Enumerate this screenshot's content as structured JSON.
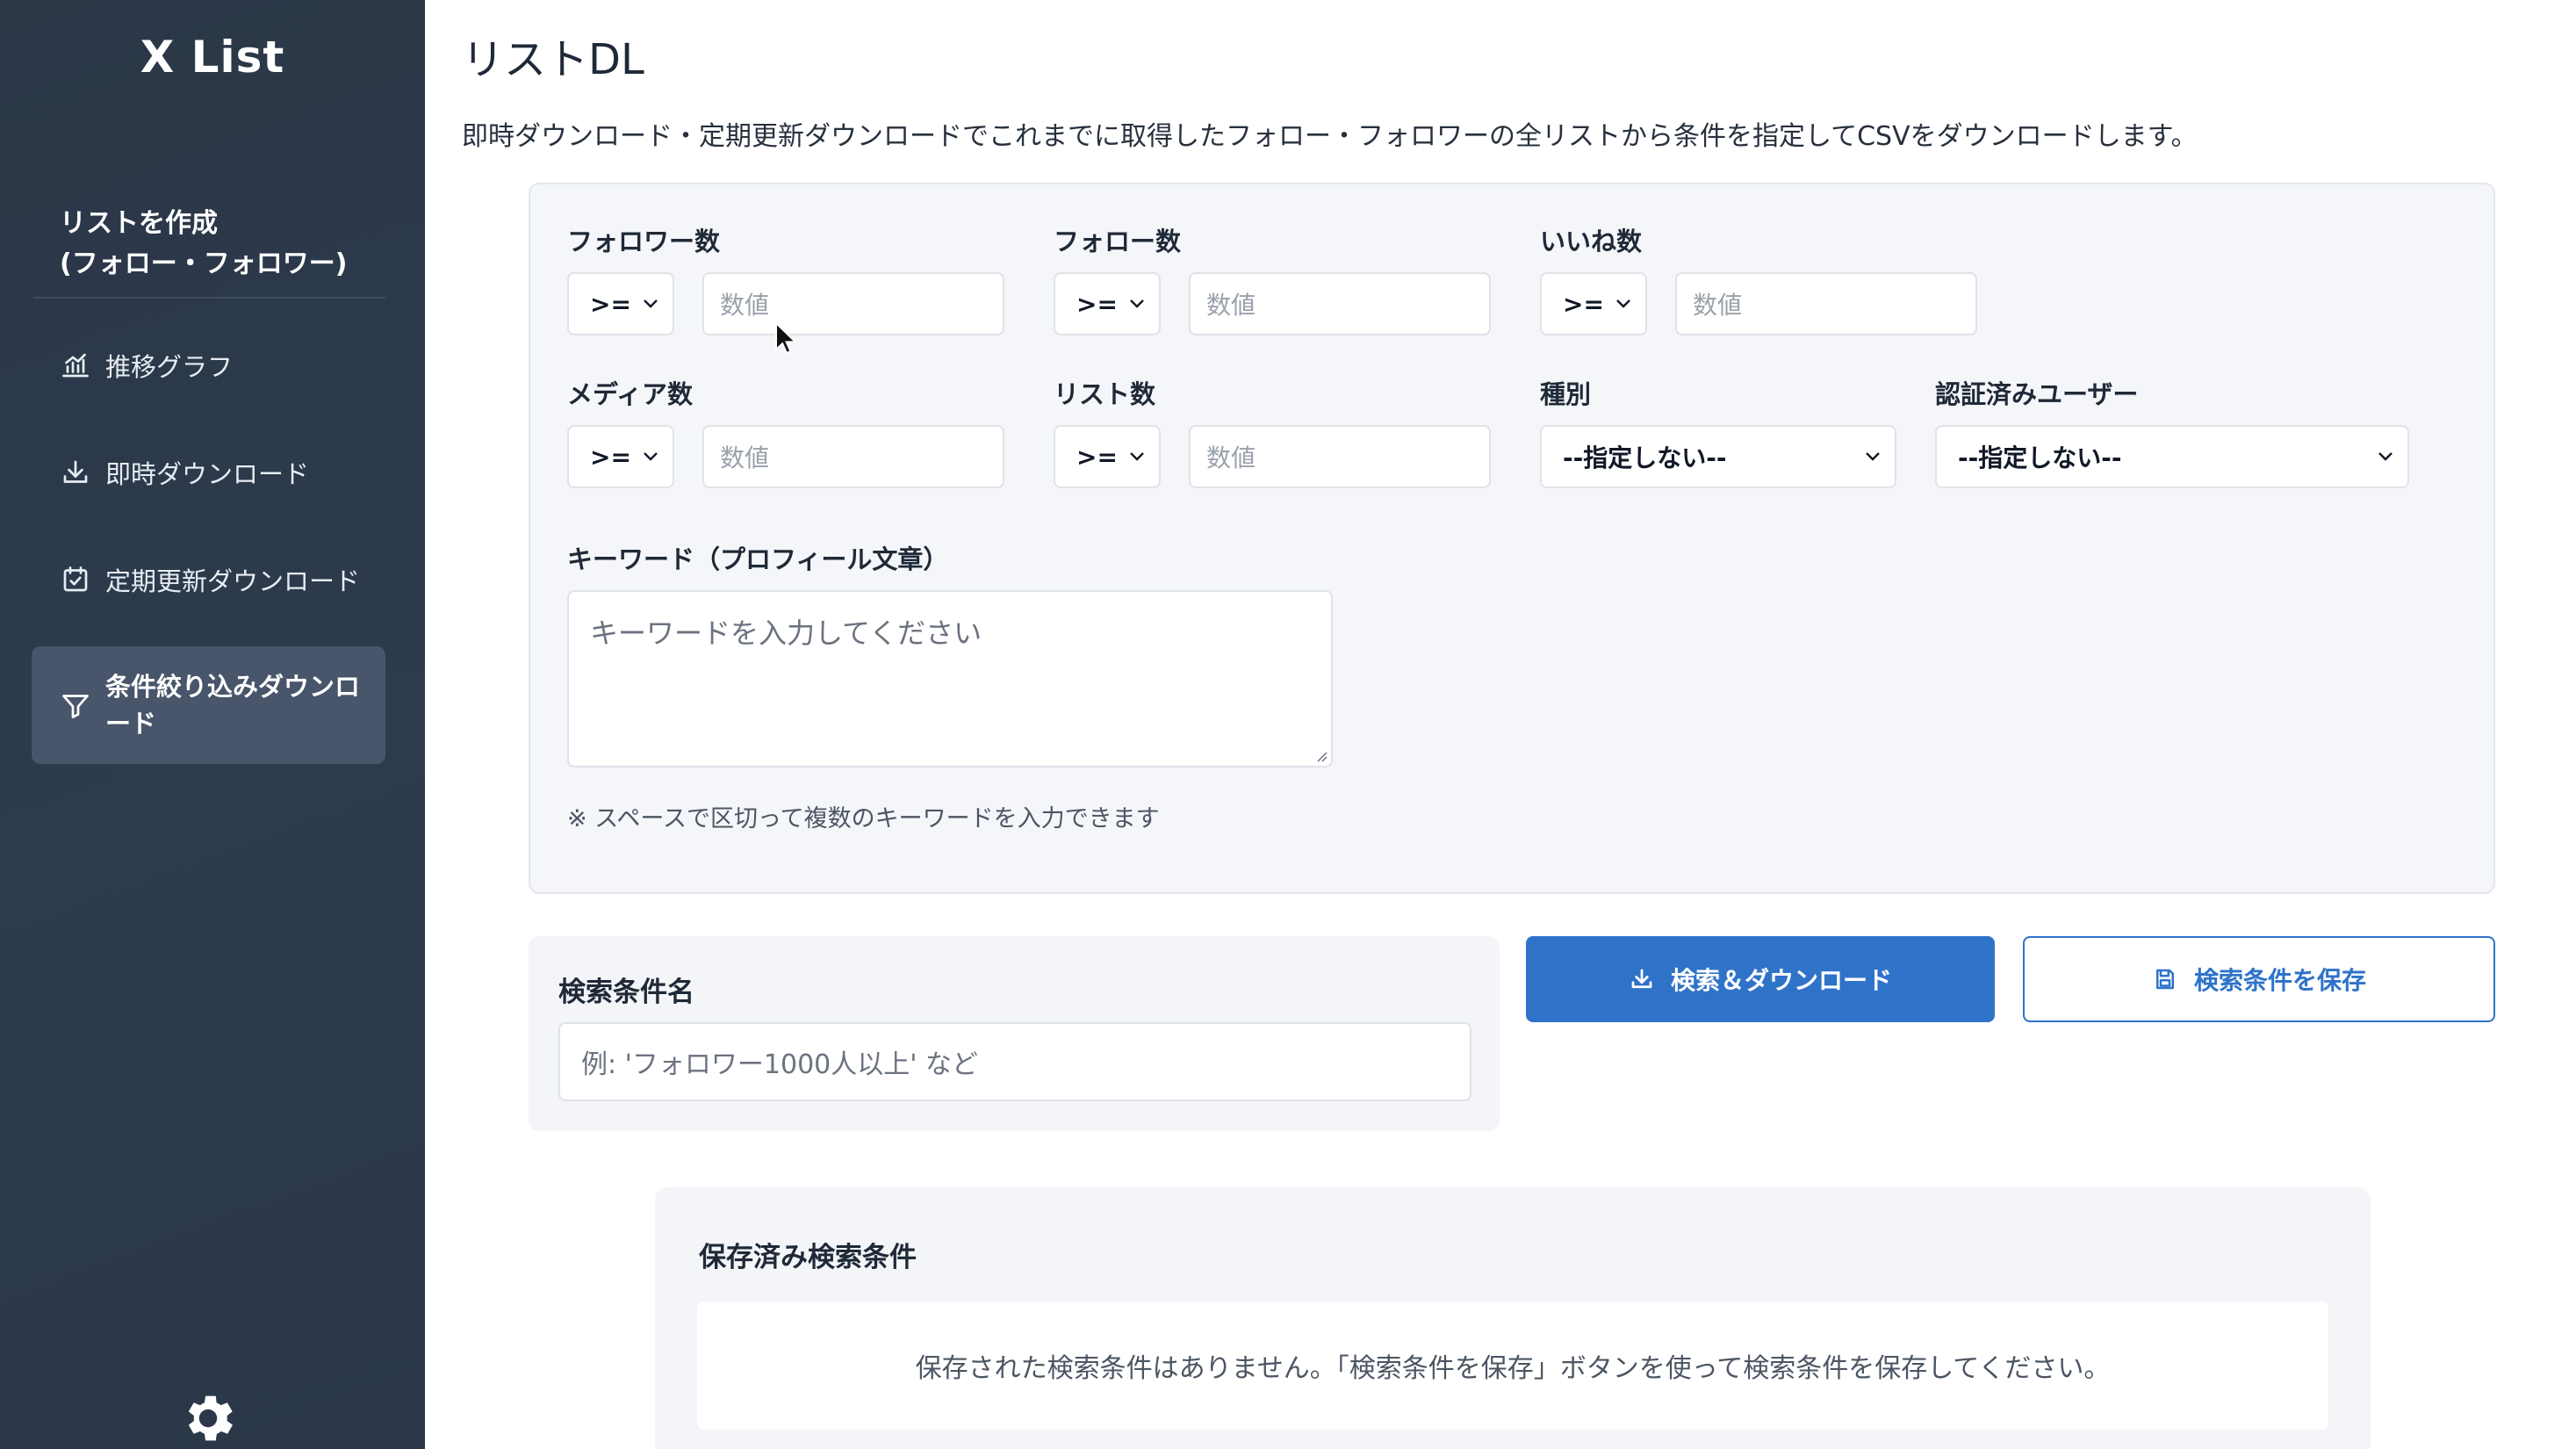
{
  "sidebar": {
    "brand": "X List",
    "heading_line1": "リストを作成",
    "heading_line2": "(フォロー・フォロワー)",
    "items": [
      {
        "label": "推移グラフ",
        "icon": "chart-icon"
      },
      {
        "label": "即時ダウンロード",
        "icon": "download-icon"
      },
      {
        "label": "定期更新ダウンロード",
        "icon": "calendar-check-icon"
      },
      {
        "label": "条件絞り込みダウンロード",
        "icon": "filter-icon",
        "active": true
      }
    ],
    "footer_icon": "gear-icon"
  },
  "page": {
    "title": "リストDL",
    "description": "即時ダウンロード・定期更新ダウンロードでこれまでに取得したフォロー・フォロワーの全リストから条件を指定してCSVをダウンロードします。"
  },
  "filters": {
    "followers": {
      "label": "フォロワー数",
      "op": ">=",
      "placeholder": "数値"
    },
    "following": {
      "label": "フォロー数",
      "op": ">=",
      "placeholder": "数値"
    },
    "likes": {
      "label": "いいね数",
      "op": ">=",
      "placeholder": "数値"
    },
    "media": {
      "label": "メディア数",
      "op": ">=",
      "placeholder": "数値"
    },
    "lists": {
      "label": "リスト数",
      "op": ">=",
      "placeholder": "数値"
    },
    "type": {
      "label": "種別",
      "value": "--指定しない--"
    },
    "verified": {
      "label": "認証済みユーザー",
      "value": "--指定しない--"
    },
    "keyword": {
      "label": "キーワード（プロフィール文章）",
      "placeholder": "キーワードを入力してください",
      "note": "※ スペースで区切って複数のキーワードを入力できます"
    }
  },
  "search_name": {
    "label": "検索条件名",
    "placeholder": "例: 'フォロワー1000人以上' など"
  },
  "actions": {
    "search_download": "検索＆ダウンロード",
    "save_conditions": "検索条件を保存"
  },
  "saved": {
    "title": "保存済み検索条件",
    "empty_message": "保存された検索条件はありません。「検索条件を保存」ボタンを使って検索条件を保存してください。"
  },
  "colors": {
    "sidebar_bg": "#2d3b4d",
    "active_item_bg": "#48556a",
    "primary": "#2f73c9",
    "card_bg": "#f4f6f9"
  }
}
